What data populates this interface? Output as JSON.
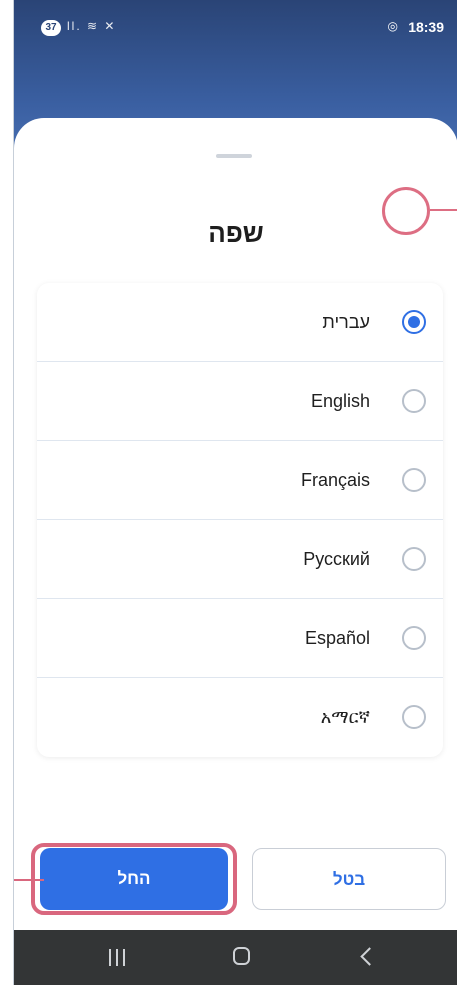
{
  "status_bar": {
    "badge": "37",
    "signal_icons": "ll. ≋ ✕",
    "rec_icon": "◎",
    "time": "18:39"
  },
  "sheet": {
    "title": "שפה"
  },
  "languages": [
    {
      "label": "עברית",
      "selected": true
    },
    {
      "label": "English",
      "selected": false
    },
    {
      "label": "Français",
      "selected": false
    },
    {
      "label": "Русский",
      "selected": false
    },
    {
      "label": "Español",
      "selected": false
    },
    {
      "label": "አማርኛ",
      "selected": false
    }
  ],
  "buttons": {
    "start": "החל",
    "cancel": "בטל"
  },
  "colors": {
    "primary": "#2f6fe4",
    "highlight": "#dd6e83",
    "header_bg": "#2a4476",
    "nav_bg": "#333536"
  },
  "nav_icons": [
    "recent-apps-icon",
    "home-icon",
    "back-icon"
  ]
}
